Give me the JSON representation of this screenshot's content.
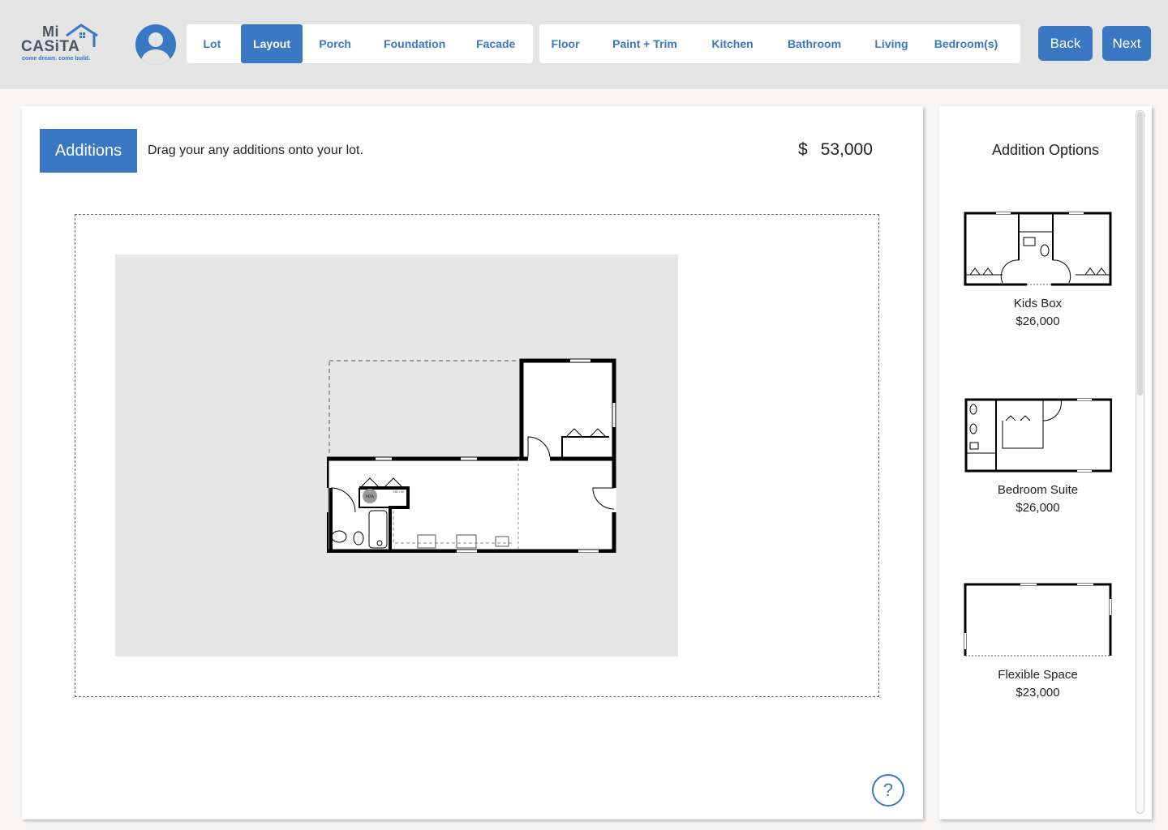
{
  "logo": {
    "line1": "Mi",
    "line2": "CASiTA",
    "tagline": "come dream. come build."
  },
  "tabs_group1": [
    {
      "label": "Lot",
      "active": false
    },
    {
      "label": "Layout",
      "active": true
    },
    {
      "label": "Porch",
      "active": false
    },
    {
      "label": "Foundation",
      "active": false
    },
    {
      "label": "Facade",
      "active": false
    }
  ],
  "tabs_group2": [
    {
      "label": "Floor",
      "active": false
    },
    {
      "label": "Paint + Trim",
      "active": false
    },
    {
      "label": "Kitchen",
      "active": false
    },
    {
      "label": "Bathroom",
      "active": false
    },
    {
      "label": "Living",
      "active": false
    },
    {
      "label": "Bedroom(s)",
      "active": false
    }
  ],
  "nav": {
    "back_label": "Back",
    "next_label": "Next"
  },
  "main": {
    "additions_label": "Additions",
    "instructions": "Drag your any additions onto your lot.",
    "price_currency": "$",
    "price_value": "53,000",
    "plan_labels": {
      "water_heater": "H/A",
      "washer_dryer": "HD / W"
    },
    "help_label": "?"
  },
  "side": {
    "title": "Addition Options",
    "options": [
      {
        "name": "Kids Box",
        "price": "$26,000"
      },
      {
        "name": "Bedroom Suite",
        "price": "$26,000"
      },
      {
        "name": "Flexible Space",
        "price": "$23,000"
      }
    ]
  },
  "colors": {
    "accent": "#3a78c4",
    "header_bg": "#e4e4e4",
    "lot_bg": "#e6e6e6"
  }
}
